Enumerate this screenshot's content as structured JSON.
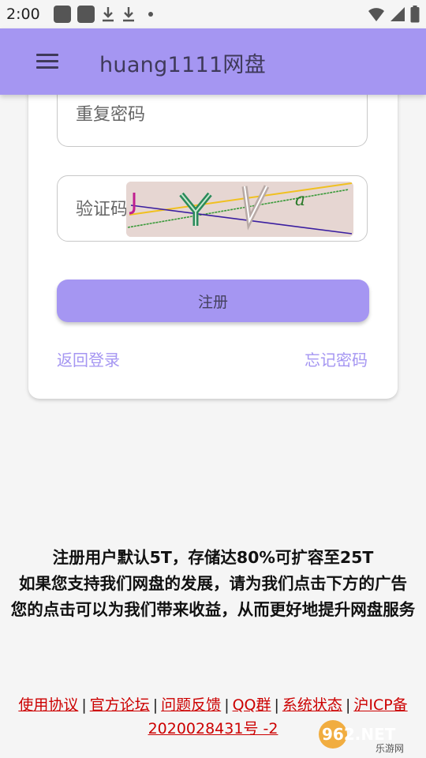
{
  "status_bar": {
    "time": "2:00"
  },
  "app_bar": {
    "title": "huang1111网盘"
  },
  "form": {
    "repeat_password_placeholder": "重复密码",
    "captcha_placeholder": "验证码",
    "register_label": "注册",
    "back_to_login": "返回登录",
    "forgot_password": "忘记密码"
  },
  "notice": {
    "line1": "注册用户默认5T，存储达80%可扩容至25T",
    "line2": "如果您支持我们网盘的发展，请为我们点击下方的广告",
    "line3": "您的点击可以为我们带来收益，从而更好地提升网盘服务"
  },
  "footer": {
    "links": [
      "使用协议",
      "官方论坛",
      "问题反馈",
      "QQ群",
      "系统状态",
      "沪ICP备2020028431号 -2"
    ],
    "separator": "|"
  },
  "watermark": {
    "brand": "962.NET",
    "sub": "乐游网"
  },
  "colors": {
    "accent": "#a596f2",
    "link_red": "#cc0000"
  }
}
